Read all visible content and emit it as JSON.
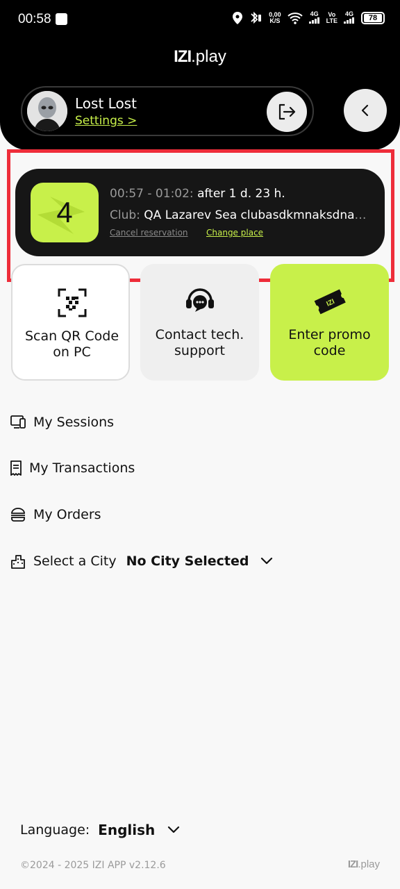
{
  "status_bar": {
    "time": "00:58",
    "net_speed_value": "0,00",
    "net_speed_unit": "K/S",
    "signal1": "4G",
    "volte_top": "Vo",
    "volte_bottom": "LTE",
    "signal2": "4G",
    "battery": "78"
  },
  "brand": {
    "logo_mark": "IZI",
    "logo_text": ".play"
  },
  "profile": {
    "name": "Lost Lost",
    "settings_link": "Settings >"
  },
  "reservation": {
    "number": "4",
    "time_range": "00:57 - 01:02:",
    "time_until": "after 1 d. 23 h.",
    "club_label": "Club:",
    "club_name": "QA Lazarev Sea clubasdkmnaksdnajsdnkasndk",
    "cancel_label": "Cancel reservation",
    "change_label": "Change place"
  },
  "tiles": {
    "scan": "Scan QR Code on PC",
    "support": "Contact tech. support",
    "promo": "Enter promo code"
  },
  "menu": {
    "sessions": "My Sessions",
    "transactions": "My Transactions",
    "orders": "My Orders",
    "city_label": "Select a City",
    "city_value": "No City Selected"
  },
  "language": {
    "label": "Language:",
    "value": "English"
  },
  "footer": {
    "copyright": "©2024 - 2025 IZI APP v2.12.6",
    "brand_mark": "IZI",
    "brand_text": ".play"
  },
  "colors": {
    "accent": "#c8f04a",
    "header": "#000000",
    "highlight": "#ee2d3a",
    "card": "#161616"
  }
}
